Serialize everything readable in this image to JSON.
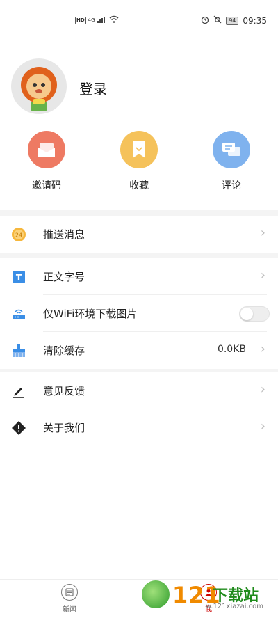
{
  "status_bar": {
    "left_text": "HD",
    "network": "4G",
    "battery": "94",
    "time": "09:35"
  },
  "profile": {
    "login_label": "登录"
  },
  "quick_actions": [
    {
      "label": "邀请码",
      "icon": "envelope-icon",
      "color": "#ee7a63"
    },
    {
      "label": "收藏",
      "icon": "bookmark-icon",
      "color": "#f5c25b"
    },
    {
      "label": "评论",
      "icon": "chat-icon",
      "color": "#7fb2ee"
    }
  ],
  "menu": {
    "push": {
      "label": "推送消息",
      "badge": "24"
    },
    "font_size": {
      "label": "正文字号"
    },
    "wifi_images": {
      "label": "仅WiFi环境下载图片",
      "enabled": false
    },
    "clear_cache": {
      "label": "清除缓存",
      "value": "0.0KB"
    },
    "feedback": {
      "label": "意见反馈"
    },
    "about": {
      "label": "关于我们"
    }
  },
  "bottom_nav": [
    {
      "label": "新闻",
      "icon": "news-icon",
      "active": false
    },
    {
      "label": "我",
      "icon": "user-icon",
      "active": true
    }
  ],
  "watermark": {
    "number": "121",
    "text": "下载站",
    "url": "w.121xiazai.com"
  }
}
